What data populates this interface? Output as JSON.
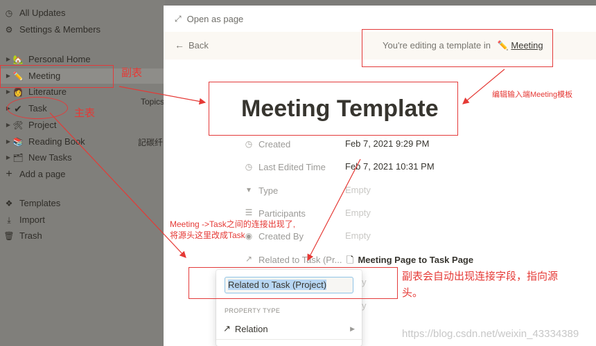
{
  "sidebar": {
    "top_items": [
      {
        "label": "All Updates",
        "icon": "clock-icon"
      },
      {
        "label": "Settings & Members",
        "icon": "gear-icon"
      }
    ],
    "pages": [
      {
        "label": "Personal Home",
        "icon": "house-icon",
        "glyph": "🏡"
      },
      {
        "label": "Meeting",
        "icon": "pencil-icon",
        "glyph": "✏️"
      },
      {
        "label": "Literature",
        "icon": "person-icon",
        "glyph": "👩"
      },
      {
        "label": "Task",
        "icon": "check-icon",
        "glyph": "✔"
      },
      {
        "label": "Project",
        "icon": "tools-icon",
        "glyph": "🛠"
      },
      {
        "label": "Reading Book",
        "icon": "books-icon",
        "glyph": "📚"
      },
      {
        "label": "New Tasks",
        "icon": "folder-icon",
        "glyph": "🗂"
      }
    ],
    "add_page": "Add a page",
    "bottom_items": [
      {
        "label": "Templates",
        "icon": "templates-icon"
      },
      {
        "label": "Import",
        "icon": "import-icon"
      },
      {
        "label": "Trash",
        "icon": "trash-icon"
      }
    ]
  },
  "background": {
    "topics": "Topics",
    "snippet": "記碳纤"
  },
  "modal": {
    "open_as_page": "Open as page",
    "back": "Back",
    "editing_prefix": "You're editing a template in",
    "template_parent": "Meeting",
    "title": "Meeting Template",
    "properties": [
      {
        "label": "Created",
        "value": "Feb 7, 2021 9:29 PM",
        "empty": false,
        "icon": "clock-icon"
      },
      {
        "label": "Last Edited Time",
        "value": "Feb 7, 2021 10:31 PM",
        "empty": false,
        "icon": "clock-icon"
      },
      {
        "label": "Type",
        "value": "Empty",
        "empty": true,
        "icon": "select-icon"
      },
      {
        "label": "Participants",
        "value": "Empty",
        "empty": true,
        "icon": "list-icon"
      },
      {
        "label": "Created By",
        "value": "Empty",
        "empty": true,
        "icon": "person-circle-icon"
      },
      {
        "label": "Related to Task (Pr...",
        "value": "Meeting Page to Task Page",
        "empty": false,
        "icon": "relation-arrow-icon"
      }
    ]
  },
  "popup": {
    "input_value": "Related to Task (Project)",
    "property_type_label": "PROPERTY TYPE",
    "type_value": "Relation"
  },
  "annotations": {
    "subtable": "副表",
    "main_table": "主表",
    "edit_note": "编辑输入端Meeting模板",
    "link_note_1": "Meeting ->Task之间的连接出现了,",
    "link_note_2": "将源头这里改成Task",
    "auto_field_1": "副表会自动出现连接字段，指向源",
    "auto_field_2": "头。",
    "color": "#e53935"
  },
  "watermark": "https://blog.csdn.net/weixin_43334389"
}
